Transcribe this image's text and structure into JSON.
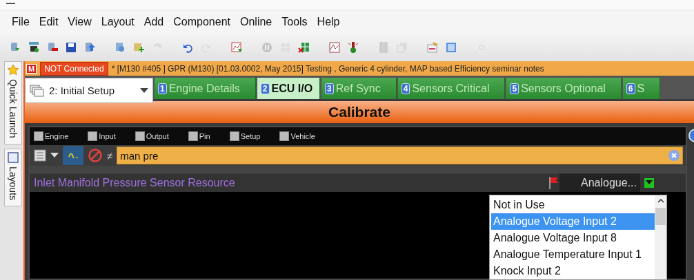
{
  "menu": [
    "File",
    "Edit",
    "View",
    "Layout",
    "Add",
    "Component",
    "Online",
    "Tools",
    "Help"
  ],
  "toolbar": [
    [
      {
        "kind": "database",
        "disabled": false
      },
      {
        "kind": "network",
        "disabled": false
      },
      {
        "kind": "remove",
        "disabled": false
      },
      {
        "kind": "save",
        "disabled": false
      },
      {
        "kind": "upload",
        "disabled": false
      }
    ],
    [
      {
        "kind": "copy",
        "disabled": false
      },
      {
        "kind": "add",
        "disabled": false
      },
      {
        "kind": "sync",
        "disabled": true
      }
    ],
    [
      {
        "kind": "undo",
        "disabled": false
      },
      {
        "kind": "redo",
        "disabled": true
      }
    ],
    [
      {
        "kind": "chart",
        "disabled": false
      }
    ],
    [
      {
        "kind": "pause",
        "disabled": true
      },
      {
        "kind": "grid",
        "disabled": true
      },
      {
        "kind": "grid-x",
        "disabled": false
      }
    ],
    [
      {
        "kind": "graph",
        "disabled": false
      },
      {
        "kind": "probe",
        "disabled": false
      }
    ],
    [
      {
        "kind": "page",
        "disabled": true
      },
      {
        "kind": "pages",
        "disabled": true
      }
    ],
    [
      {
        "kind": "notes",
        "disabled": false
      },
      {
        "kind": "window",
        "disabled": false
      }
    ],
    [
      {
        "kind": "find",
        "disabled": true
      }
    ]
  ],
  "side_tabs": [
    {
      "kind": "star",
      "label": "Quick Launch"
    },
    {
      "kind": "square",
      "label": "Layouts"
    }
  ],
  "status": {
    "badge": "M",
    "connection": "NOT Connected",
    "text": "* [M130 #405 ]  GPR (M130) [01.03.0002, May 2015] Testing , Generic 4 cylinder, MAP based Efficiency seminar notes"
  },
  "workbook": {
    "value": "2: Initial Setup"
  },
  "tabs": [
    {
      "number": "1",
      "label": "Engine Details",
      "selected": false
    },
    {
      "number": "2",
      "label": "ECU I/O",
      "selected": true
    },
    {
      "number": "3",
      "label": "Ref Sync",
      "selected": false
    },
    {
      "number": "4",
      "label": "Sensors Critical",
      "selected": false
    },
    {
      "number": "5",
      "label": "Sensors Optional",
      "selected": false
    },
    {
      "number": "6",
      "label": "S",
      "selected": false
    }
  ],
  "title": "Calibrate",
  "filters": [
    {
      "label": "Engine",
      "checked": false
    },
    {
      "label": "Input",
      "checked": false
    },
    {
      "label": "Output",
      "checked": false
    },
    {
      "label": "Pin",
      "checked": false
    },
    {
      "label": "Setup",
      "checked": false
    },
    {
      "label": "Vehicle",
      "checked": false
    }
  ],
  "filter_bar": {
    "wave_on": true,
    "not_equal": "≠",
    "search": "man pre"
  },
  "row": {
    "name": "Inlet Manifold Pressure Sensor Resource",
    "flagged": true,
    "value": "Analogue..."
  },
  "options": [
    {
      "label": "Not in Use",
      "selected": false
    },
    {
      "label": "Analogue Voltage Input 2",
      "selected": true
    },
    {
      "label": "Analogue Voltage Input 8",
      "selected": false
    },
    {
      "label": "Analogue Temperature Input 1",
      "selected": false
    },
    {
      "label": "Knock Input 2",
      "selected": false
    }
  ]
}
